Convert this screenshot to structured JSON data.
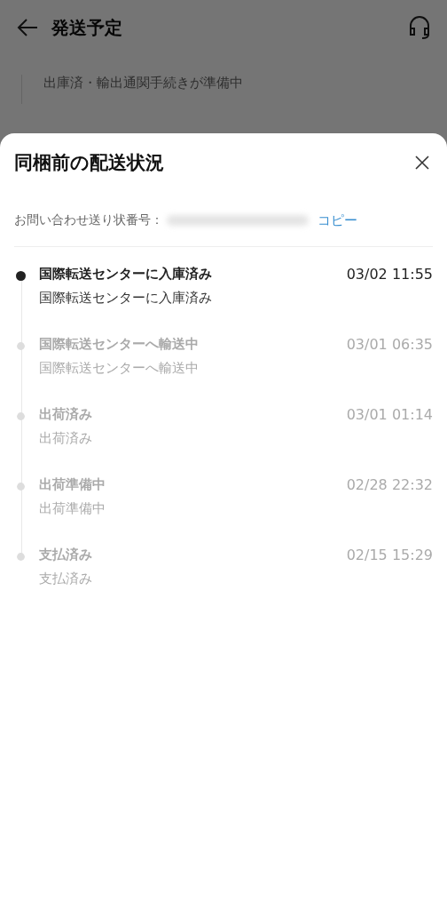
{
  "page": {
    "title": "発送予定",
    "items": [
      {
        "detail": "出庫済・輸出通関手続きが準備中"
      }
    ]
  },
  "sheet": {
    "title": "同梱前の配送状況",
    "tracking_label": "お問い合わせ送り状番号：",
    "copy_link": "コピー",
    "events": [
      {
        "status": "国際転送センターに入庫済み",
        "time": "03/02 11:55",
        "detail": "国際転送センターに入庫済み",
        "current": true
      },
      {
        "status": "国際転送センターへ輸送中",
        "time": "03/01 06:35",
        "detail": "国際転送センターへ輸送中",
        "current": false
      },
      {
        "status": "出荷済み",
        "time": "03/01 01:14",
        "detail": "出荷済み",
        "current": false
      },
      {
        "status": "出荷準備中",
        "time": "02/28 22:32",
        "detail": "出荷準備中",
        "current": false
      },
      {
        "status": "支払済み",
        "time": "02/15 15:29",
        "detail": "支払済み",
        "current": false
      }
    ]
  }
}
